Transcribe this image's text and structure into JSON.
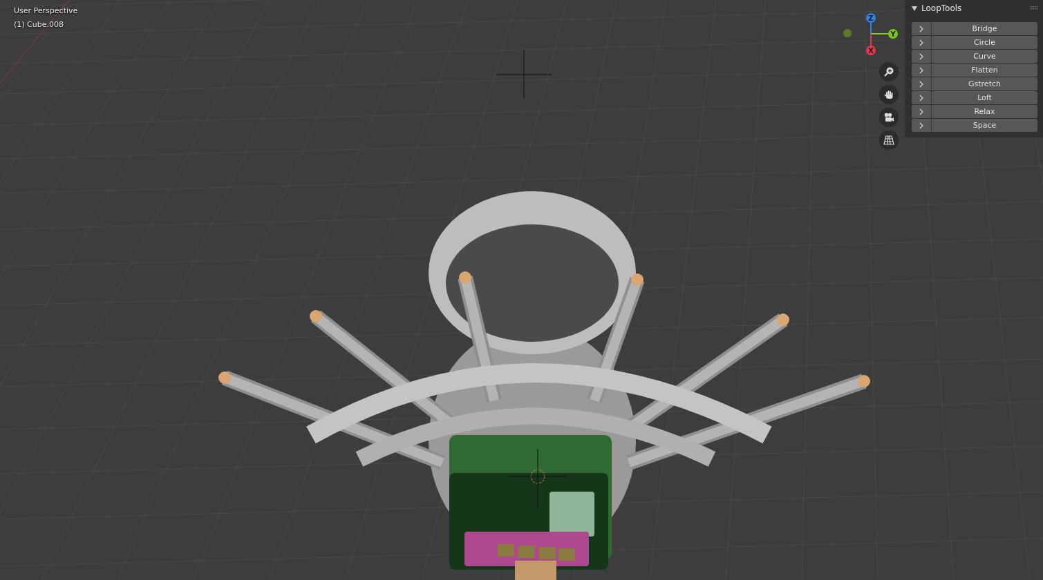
{
  "viewport": {
    "view_name": "User Perspective",
    "object_name": "(1) Cube.008"
  },
  "gizmo": {
    "axes": [
      {
        "label": "Z",
        "color": "#2e85e8"
      },
      {
        "label": "Y",
        "color": "#7ec61c"
      },
      {
        "label": "X",
        "color": "#e8344e"
      }
    ]
  },
  "panel": {
    "title": "LoopTools",
    "expanded": true,
    "items": [
      {
        "label": "Bridge",
        "expanded": false
      },
      {
        "label": "Circle",
        "expanded": false
      },
      {
        "label": "Curve",
        "expanded": false
      },
      {
        "label": "Flatten",
        "expanded": false
      },
      {
        "label": "Gstretch",
        "expanded": false
      },
      {
        "label": "Loft",
        "expanded": false
      },
      {
        "label": "Relax",
        "expanded": false
      },
      {
        "label": "Space",
        "expanded": false
      }
    ]
  }
}
